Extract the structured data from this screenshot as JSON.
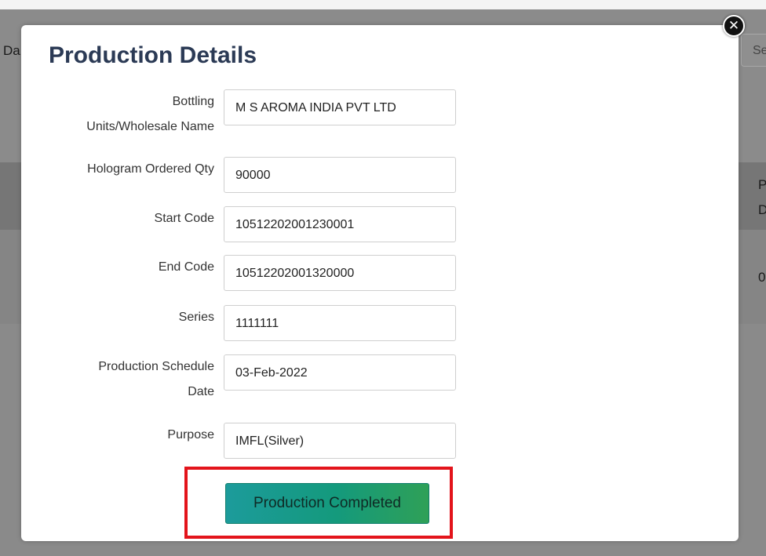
{
  "background": {
    "left_text": "Da",
    "right_box_text": "Se",
    "right_band_text_1": "P",
    "right_band_text_2": "D",
    "right_mid_text": "0"
  },
  "modal": {
    "title": "Production Details",
    "fields": [
      {
        "label_lines": [
          "Bottling",
          "Units/Wholesale Name"
        ],
        "value": "M S AROMA INDIA PVT LTD"
      },
      {
        "label_lines": [
          "Hologram Ordered Qty"
        ],
        "value": "90000"
      },
      {
        "label_lines": [
          "Start Code"
        ],
        "value": "10512202001230001"
      },
      {
        "label_lines": [
          "End Code"
        ],
        "value": "10512202001320000"
      },
      {
        "label_lines": [
          "Series"
        ],
        "value": "1111111"
      },
      {
        "label_lines": [
          "Production Schedule",
          "Date"
        ],
        "value": "03-Feb-2022"
      },
      {
        "label_lines": [
          "Purpose"
        ],
        "value": "IMFL(Silver)"
      }
    ],
    "button_label": "Production Completed",
    "close_icon": "close-icon",
    "highlight_color": "#e3141b"
  }
}
